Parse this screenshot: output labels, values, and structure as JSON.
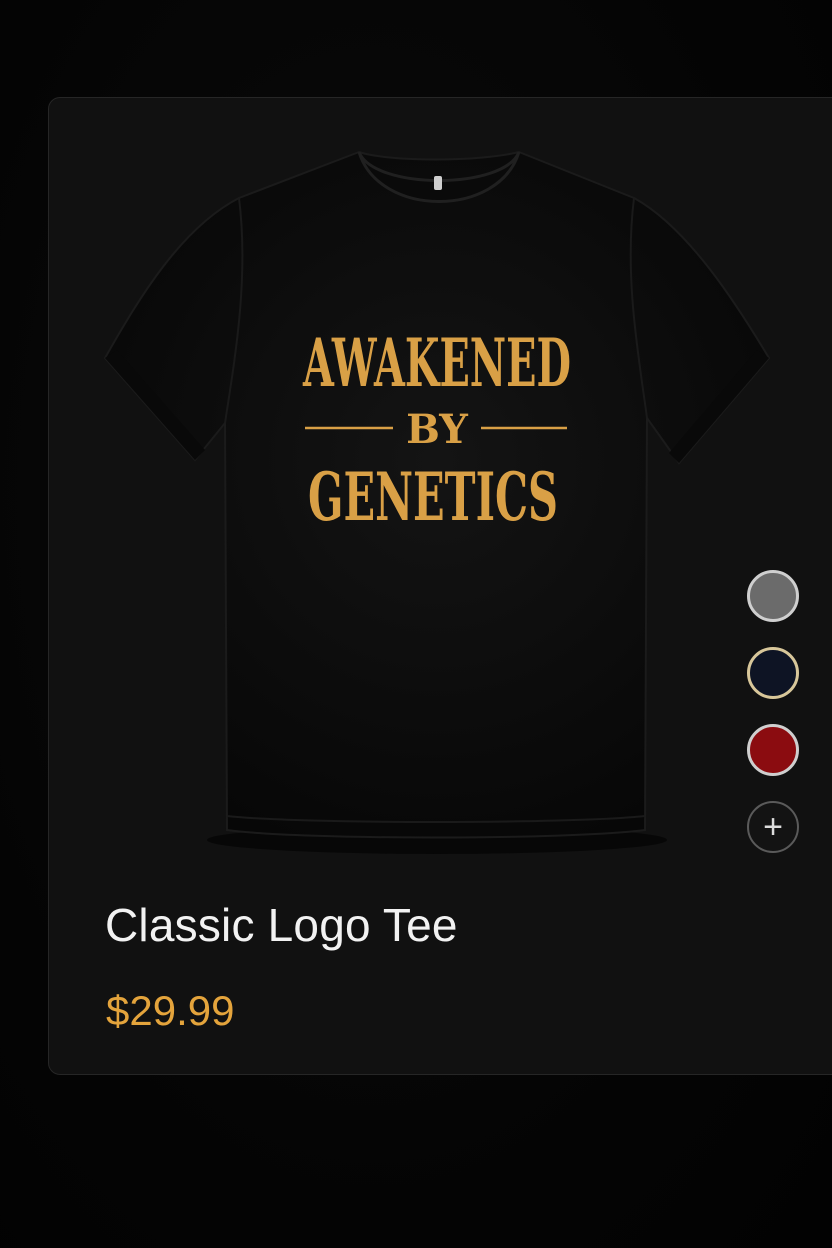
{
  "product": {
    "title": "Classic Logo Tee",
    "price": "$29.99",
    "print": {
      "line1": "AWAKENED",
      "line2": "BY",
      "line3": "GENETICS"
    },
    "shirt_color": "#0d0d0d",
    "print_color": "#d9a046",
    "price_color": "#e4a43c"
  },
  "swatches": [
    {
      "name": "gray",
      "color": "#6b6b6b"
    },
    {
      "name": "navy",
      "color": "#0e1424"
    },
    {
      "name": "red",
      "color": "#8b0c10"
    }
  ],
  "add_swatch": {
    "icon": "plus-icon",
    "glyph": "+"
  }
}
